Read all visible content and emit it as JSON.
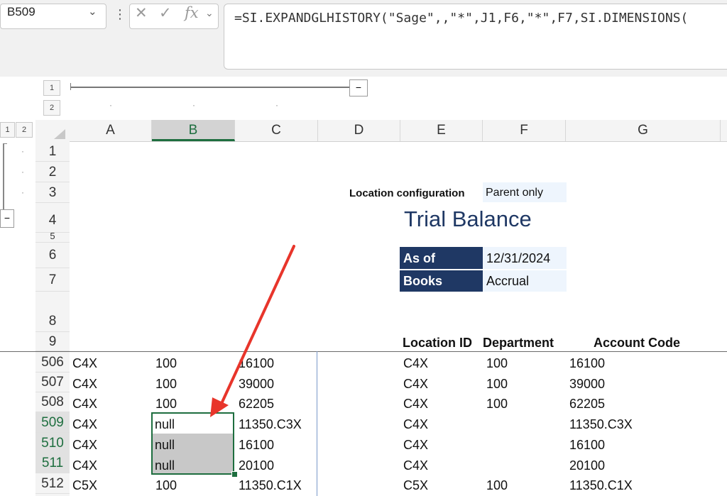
{
  "formula_bar": {
    "name_box": "B509",
    "formula": "=SI.EXPANDGLHISTORY(\"Sage\",,\"*\",J1,F6,\"*\",F7,SI.DIMENSIONS(",
    "cancel_icon": "x-icon",
    "enter_icon": "check-icon",
    "fx_icon": "fx-icon"
  },
  "outline": {
    "column_levels": [
      "1",
      "2"
    ],
    "row_levels": [
      "1",
      "2"
    ],
    "collapse_label": "−"
  },
  "columns": [
    "A",
    "B",
    "C",
    "D",
    "E",
    "F",
    "G"
  ],
  "selected_column": "B",
  "rows": [
    "1",
    "2",
    "3",
    "4",
    "5",
    "6",
    "7",
    "8",
    "9",
    "506",
    "507",
    "508",
    "509",
    "510",
    "511",
    "512"
  ],
  "header": {
    "location_config_label": "Location configuration",
    "location_config_value": "Parent only",
    "title": "Trial Balance",
    "as_of_label": "As of",
    "as_of_value": "12/31/2024",
    "books_label": "Books",
    "books_value": "Accrual",
    "col_location_id": "Location ID",
    "col_department": "Department",
    "col_account_code": "Account Code"
  },
  "data_rows": [
    {
      "row": "506",
      "a": "C4X",
      "b": "100",
      "c": "16100",
      "e": "C4X",
      "f": "100",
      "g": "16100"
    },
    {
      "row": "507",
      "a": "C4X",
      "b": "100",
      "c": "39000",
      "e": "C4X",
      "f": "100",
      "g": "39000"
    },
    {
      "row": "508",
      "a": "C4X",
      "b": "100",
      "c": "62205",
      "e": "C4X",
      "f": "100",
      "g": "62205"
    },
    {
      "row": "509",
      "a": "C4X",
      "b": "null",
      "c": "11350.C3X",
      "e": "C4X",
      "f": "",
      "g": "11350.C3X"
    },
    {
      "row": "510",
      "a": "C4X",
      "b": "null",
      "c": "16100",
      "e": "C4X",
      "f": "",
      "g": "16100"
    },
    {
      "row": "511",
      "a": "C4X",
      "b": "null",
      "c": "20100",
      "e": "C4X",
      "f": "",
      "g": "20100"
    },
    {
      "row": "512",
      "a": "C5X",
      "b": "100",
      "c": "11350.C1X",
      "e": "C5X",
      "f": "100",
      "g": "11350.C1X"
    }
  ],
  "annotation": {
    "arrow_color": "#e8352b"
  },
  "colors": {
    "accent_green": "#1e6e3f",
    "navy": "#1f3864",
    "title_blue": "#1f3864"
  }
}
